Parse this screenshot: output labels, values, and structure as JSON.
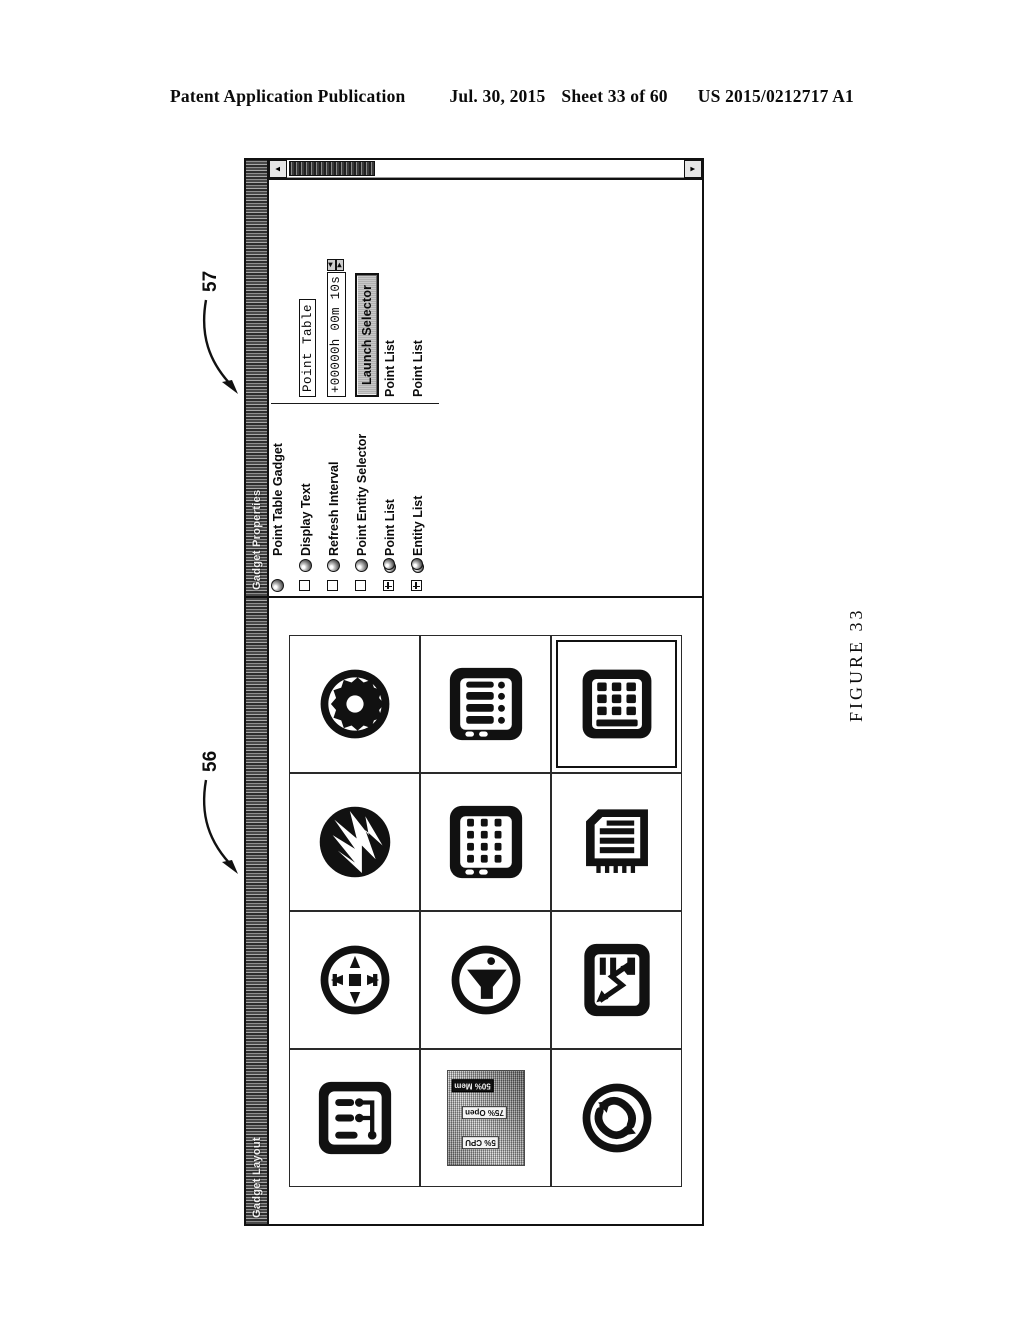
{
  "patent_header": {
    "publication": "Patent Application Publication",
    "date": "Jul. 30, 2015",
    "sheet": "Sheet 33 of 60",
    "number": "US 2015/0212717 A1"
  },
  "figure": {
    "caption": "FIGURE 33"
  },
  "callouts": [
    {
      "label": "57",
      "target": "gadget-properties-window"
    },
    {
      "label": "56",
      "target": "gadget-layout-window"
    }
  ],
  "properties_window": {
    "title": "Gadget Properties",
    "scrollbar": {
      "up_arrow": "▲",
      "down_arrow": "▼"
    },
    "rows": [
      {
        "control": "none",
        "icon": "sphere-icon",
        "label": "Point Table Gadget",
        "value": "",
        "value_type": "none"
      },
      {
        "control": "checkbox",
        "icon": "sphere-icon",
        "label": "Display Text",
        "value": "Point Table",
        "value_type": "text"
      },
      {
        "control": "checkbox",
        "icon": "sphere-icon",
        "label": "Refresh Interval",
        "value": "+00000h 00m 10s",
        "value_type": "spinner"
      },
      {
        "control": "checkbox",
        "icon": "sphere-icon",
        "label": "Point Entity Selector",
        "value": "Launch Selector",
        "value_type": "button"
      },
      {
        "control": "plusbox",
        "icon": "spheres-icon",
        "label": "Point List",
        "value": "Point List",
        "value_type": "plain"
      },
      {
        "control": "plusbox",
        "icon": "spheres-icon",
        "label": "Entity List",
        "value": "Point List",
        "value_type": "plain"
      }
    ],
    "spinner_up": "◀",
    "spinner_down": "▶"
  },
  "layout_window": {
    "title": "Gadget Layout",
    "grid": {
      "columns": 4,
      "rows": 3
    },
    "cells": [
      {
        "name": "schematic-gadget-icon",
        "icon": "schematic",
        "selected": false
      },
      {
        "name": "gauge-gadget-icon",
        "icon": "compass",
        "selected": false
      },
      {
        "name": "waveform-gadget-icon",
        "icon": "waveform",
        "selected": false
      },
      {
        "name": "gear-gadget-icon",
        "icon": "gear",
        "selected": false
      },
      {
        "name": "preview-thumbnail",
        "icon": "thumbnail",
        "selected": false
      },
      {
        "name": "speaker-gadget-icon",
        "icon": "speaker",
        "selected": false
      },
      {
        "name": "keypad-gadget-icon",
        "icon": "keypad",
        "selected": false
      },
      {
        "name": "slider-bank-gadget-icon",
        "icon": "sliders",
        "selected": false
      },
      {
        "name": "refresh-gadget-icon",
        "icon": "refresh",
        "selected": false
      },
      {
        "name": "trend-chart-gadget-icon",
        "icon": "trend",
        "selected": false
      },
      {
        "name": "list-document-gadget-icon",
        "icon": "document",
        "selected": false
      },
      {
        "name": "point-table-gadget-icon",
        "icon": "table",
        "selected": true
      }
    ],
    "thumbnail_labels": [
      "5% CPU",
      "75% Open",
      "50% Mem"
    ]
  }
}
